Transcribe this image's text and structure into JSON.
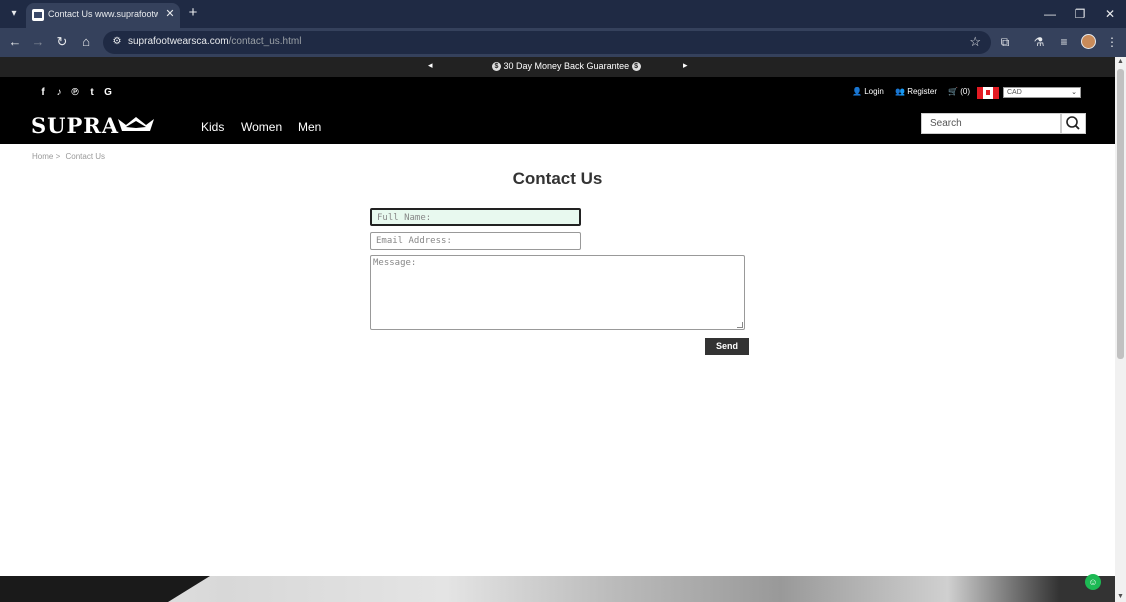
{
  "browser": {
    "tab_title": "Contact Us www.suprafootwear",
    "url_host": "suprafootwearsca.com",
    "url_path": "/contact_us.html"
  },
  "promo": {
    "text": "30 Day Money Back Guarantee",
    "prev": "◂",
    "next": "▸"
  },
  "header": {
    "logo": "SUPRA",
    "nav": [
      "Kids",
      "Women",
      "Men"
    ],
    "login": "Login",
    "register": "Register",
    "cart": "(0)",
    "currency": "CAD",
    "search_placeholder": "Search"
  },
  "breadcrumb": {
    "home": "Home",
    "separator": ">",
    "current": "Contact Us"
  },
  "form": {
    "title": "Contact Us",
    "full_name_placeholder": "Full Name:",
    "email_placeholder": "Email Address:",
    "message_placeholder": "Message:",
    "send_label": "Send"
  },
  "icons": {
    "social": [
      "facebook-icon",
      "twitter-icon",
      "pinterest-icon",
      "tumblr-icon",
      "google-icon"
    ]
  },
  "colors": {
    "header_bg": "#000000",
    "focus_bg": "#e8f9ef",
    "send_bg": "#333333",
    "chat": "#1db954"
  }
}
